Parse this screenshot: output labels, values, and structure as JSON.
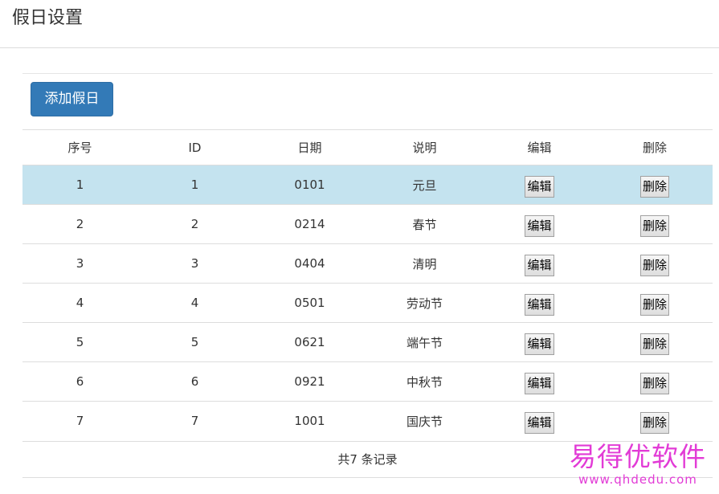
{
  "header": {
    "title": "假日设置"
  },
  "toolbar": {
    "add_label": "添加假日"
  },
  "table": {
    "columns": [
      "序号",
      "ID",
      "日期",
      "说明",
      "编辑",
      "删除"
    ],
    "rows": [
      {
        "seq": "1",
        "id": "1",
        "date": "0101",
        "desc": "元旦",
        "edit": "编辑",
        "delete": "删除",
        "highlighted": true
      },
      {
        "seq": "2",
        "id": "2",
        "date": "0214",
        "desc": "春节",
        "edit": "编辑",
        "delete": "删除"
      },
      {
        "seq": "3",
        "id": "3",
        "date": "0404",
        "desc": "清明",
        "edit": "编辑",
        "delete": "删除"
      },
      {
        "seq": "4",
        "id": "4",
        "date": "0501",
        "desc": "劳动节",
        "edit": "编辑",
        "delete": "删除"
      },
      {
        "seq": "5",
        "id": "5",
        "date": "0621",
        "desc": "端午节",
        "edit": "编辑",
        "delete": "删除"
      },
      {
        "seq": "6",
        "id": "6",
        "date": "0921",
        "desc": "中秋节",
        "edit": "编辑",
        "delete": "删除"
      },
      {
        "seq": "7",
        "id": "7",
        "date": "1001",
        "desc": "国庆节",
        "edit": "编辑",
        "delete": "删除"
      }
    ],
    "footer": "共7 条记录"
  },
  "watermark": {
    "title": "易得优软件",
    "url": "www.qhdedu.com",
    "color": "#e23bd6"
  },
  "colors": {
    "primary": "#337ab7",
    "row_highlight": "#c4e3ef"
  }
}
